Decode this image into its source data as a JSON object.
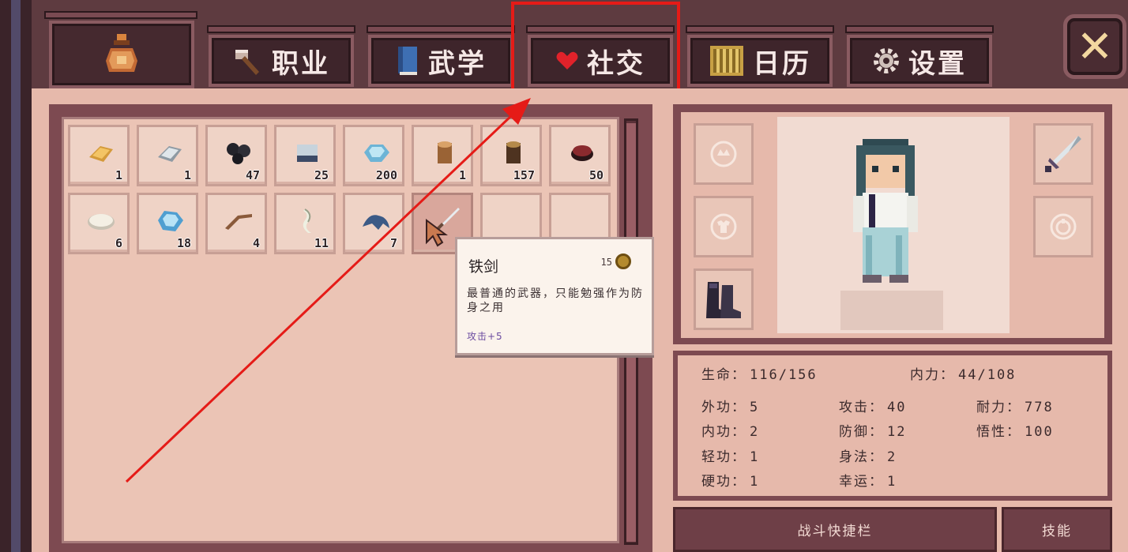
{
  "tabs": {
    "job": "职业",
    "martial": "武学",
    "social": "社交",
    "calendar": "日历",
    "settings": "设置"
  },
  "close_glyph": "✕",
  "inventory": {
    "items": [
      {
        "icon": "gold-ingot",
        "count": "1"
      },
      {
        "icon": "silver-ingot",
        "count": "1"
      },
      {
        "icon": "coal-ore",
        "count": "47"
      },
      {
        "icon": "iron-block",
        "count": "25"
      },
      {
        "icon": "blue-crystal",
        "count": "200"
      },
      {
        "icon": "wood-log",
        "count": "1"
      },
      {
        "icon": "dark-log",
        "count": "157"
      },
      {
        "icon": "red-disc",
        "count": "50"
      },
      {
        "icon": "white-cotton",
        "count": "6"
      },
      {
        "icon": "ice-crystal",
        "count": "18"
      },
      {
        "icon": "bent-stick",
        "count": "4"
      },
      {
        "icon": "white-feather",
        "count": "11"
      },
      {
        "icon": "blue-cloth",
        "count": "7"
      },
      {
        "icon": "iron-sword",
        "count": ""
      },
      {
        "icon": "empty",
        "count": ""
      },
      {
        "icon": "empty",
        "count": ""
      }
    ]
  },
  "tooltip": {
    "name": "铁剑",
    "price": "15",
    "desc": "最普通的武器，只能勉强作为防身之用",
    "stat": "攻击+5"
  },
  "stats": {
    "hp_label": "生命：",
    "hp_value": "116/156",
    "mp_label": "内力：",
    "mp_value": "44/108",
    "waigong_label": "外功：",
    "waigong_value": "5",
    "attack_label": "攻击：",
    "attack_value": "40",
    "endurance_label": "耐力：",
    "endurance_value": "778",
    "neigong_label": "内功：",
    "neigong_value": "2",
    "defense_label": "防御：",
    "defense_value": "12",
    "wisdom_label": "悟性：",
    "wisdom_value": "100",
    "qinggong_label": "轻功：",
    "qinggong_value": "1",
    "agility_label": "身法：",
    "agility_value": "2",
    "yinggong_label": "硬功：",
    "yinggong_value": "1",
    "luck_label": "幸运：",
    "luck_value": "1"
  },
  "bottom": {
    "combat_bar": "战斗快捷栏",
    "skills": "技能"
  },
  "colors": {
    "annotation_red": "#e51b17",
    "panel_frame": "#7d4a51",
    "panel_fill": "#e6b9ab"
  }
}
